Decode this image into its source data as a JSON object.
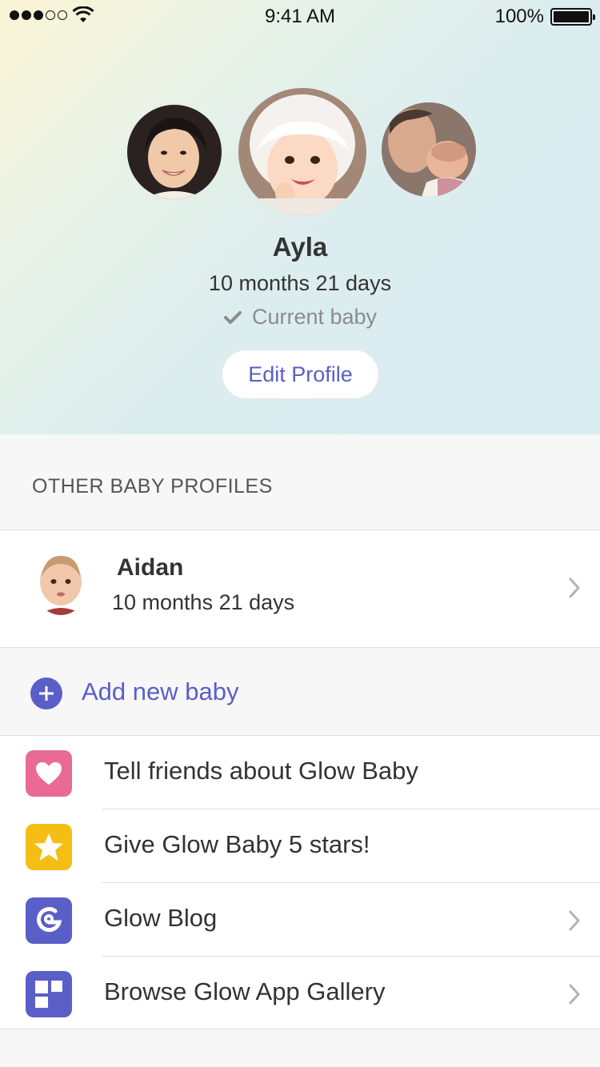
{
  "status_bar": {
    "time": "9:41 AM",
    "battery_text": "100%",
    "signal_bars_filled": 3,
    "signal_bars_total": 5
  },
  "profile": {
    "name": "Ayla",
    "age": "10 months 21 days",
    "current_label": "Current baby",
    "edit_button": "Edit Profile"
  },
  "other_profiles": {
    "section_title": "OTHER BABY PROFILES",
    "items": [
      {
        "name": "Aidan",
        "age": "10 months 21 days"
      }
    ],
    "add_label": "Add new baby"
  },
  "menu": {
    "items": [
      {
        "label": "Tell friends about Glow Baby",
        "icon": "heart-icon",
        "color": "#e96a93",
        "chevron": false
      },
      {
        "label": "Give Glow Baby 5 stars!",
        "icon": "star-icon",
        "color": "#f5be15",
        "chevron": false
      },
      {
        "label": "Glow Blog",
        "icon": "glow-logo-icon",
        "color": "#5a5fc8",
        "chevron": true
      },
      {
        "label": "Browse Glow App Gallery",
        "icon": "app-gallery-icon",
        "color": "#5a5fc8",
        "chevron": true
      }
    ]
  },
  "colors": {
    "accent": "#5a5fc8",
    "text": "#333333",
    "muted": "#8c8c8c"
  }
}
